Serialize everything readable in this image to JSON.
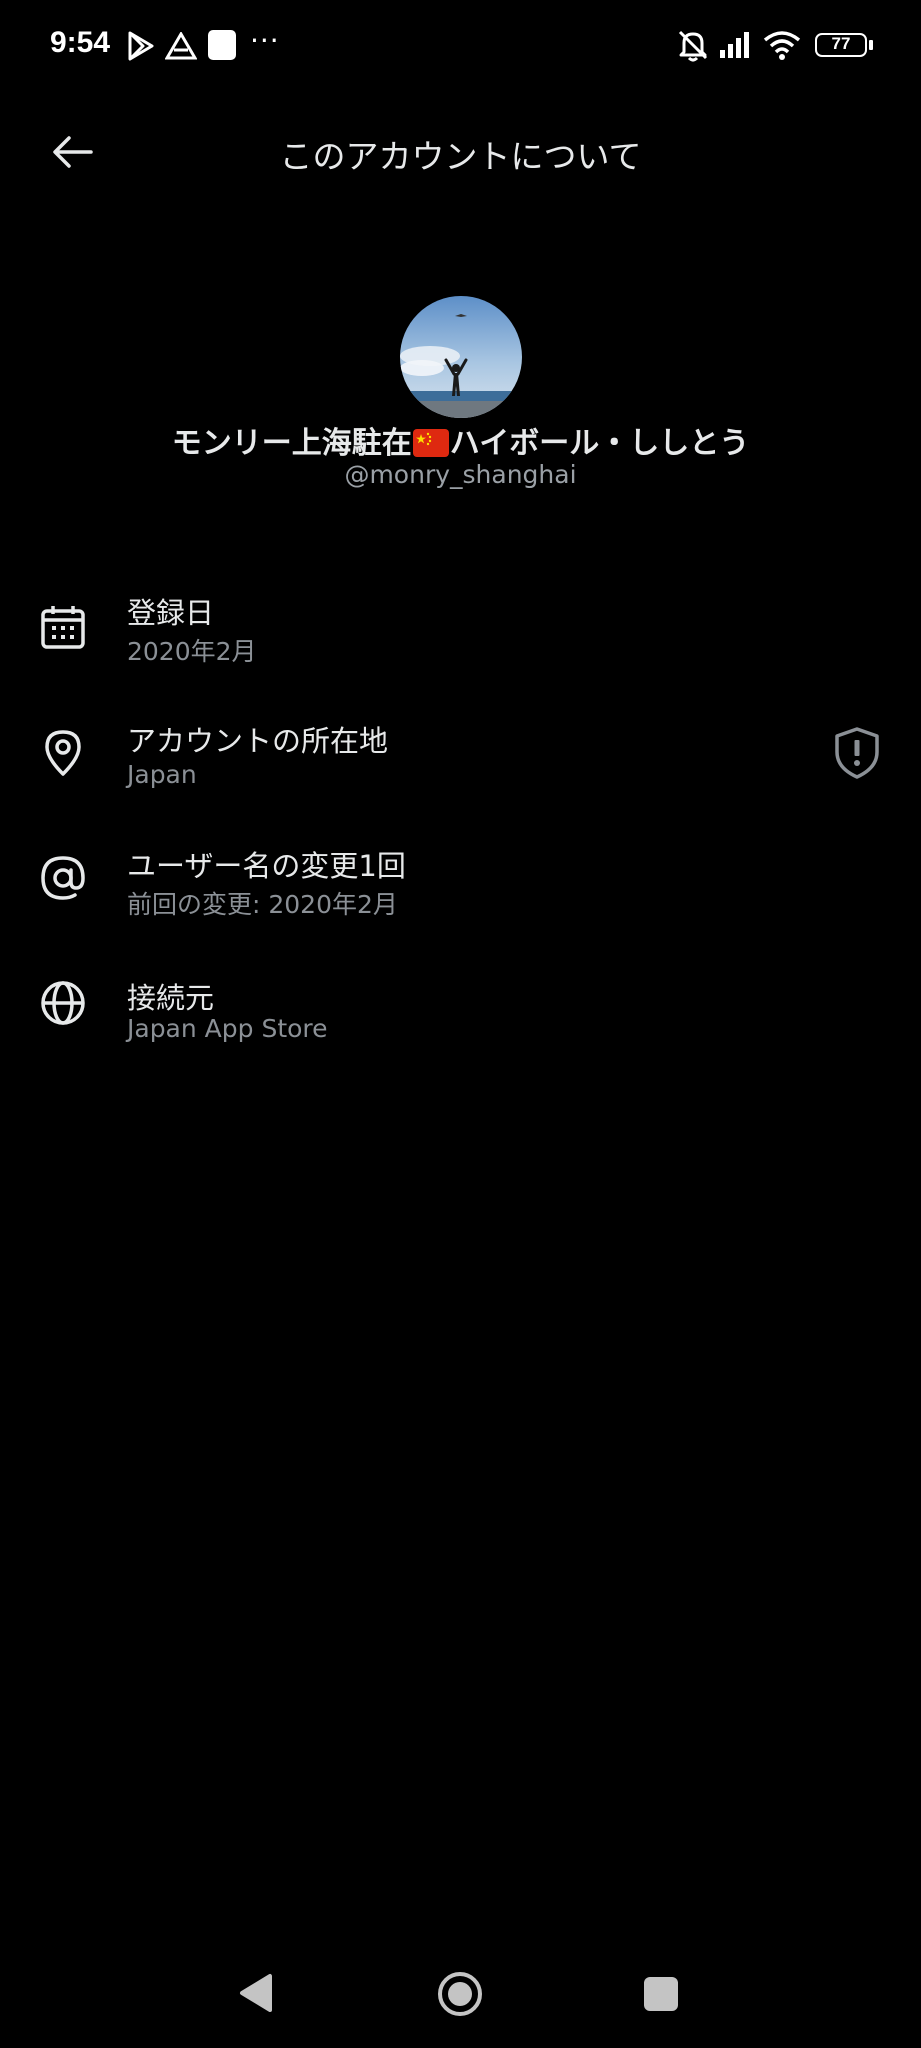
{
  "status_bar": {
    "time": "9:54",
    "more": "···",
    "battery": "77",
    "icons": [
      "play-store-icon",
      "drive-icon",
      "app-icon",
      "silent-bell-icon",
      "signal-icon",
      "wifi-icon",
      "battery-icon"
    ]
  },
  "header": {
    "title": "このアカウントについて",
    "back_icon": "arrow-left-icon"
  },
  "profile": {
    "name_before_flag": "モンリー上海駐在",
    "name_after_flag": "ハイボール・ししとう",
    "handle": "@monry_shanghai"
  },
  "rows": [
    {
      "icon": "calendar-icon",
      "title": "登録日",
      "subtitle": "2020年2月"
    },
    {
      "icon": "location-pin-icon",
      "title": "アカウントの所在地",
      "subtitle": "Japan",
      "badge_icon": "shield-alert-icon"
    },
    {
      "icon": "at-sign-icon",
      "title": "ユーザー名の変更1回",
      "subtitle": "前回の変更: 2020年2月"
    },
    {
      "icon": "globe-icon",
      "title": "接続元",
      "subtitle": "Japan App Store"
    }
  ],
  "nav_bar": {
    "icons": [
      "nav-back-icon",
      "nav-home-icon",
      "nav-recents-icon"
    ]
  },
  "colors": {
    "background": "#000000",
    "primary_text": "#e7e9ea",
    "secondary_text": "#8b9096",
    "icon": "#e7e9ea"
  }
}
